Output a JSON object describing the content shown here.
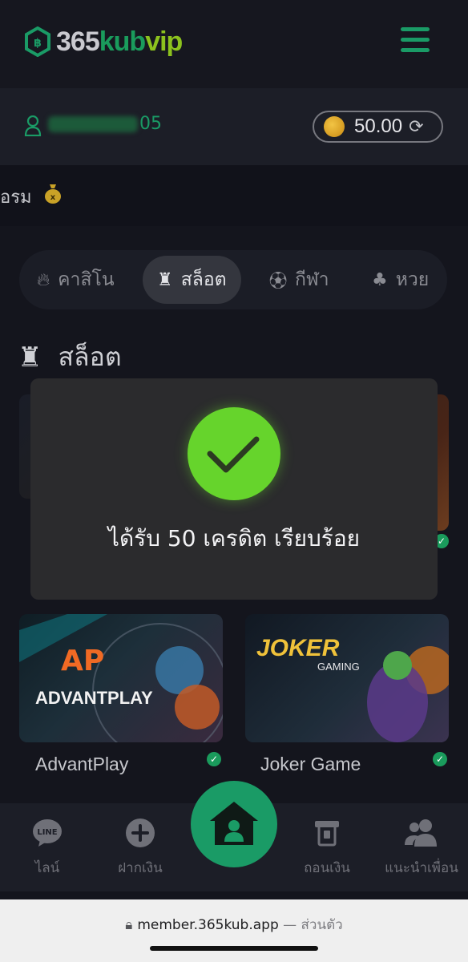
{
  "header": {
    "logo": {
      "part1": "365",
      "part2": "kub",
      "part3": "vip"
    },
    "menu_icon": "hamburger-icon"
  },
  "user": {
    "id_suffix": "05",
    "balance": "50.00",
    "icon": "user-icon"
  },
  "marquee": {
    "text": "อรม"
  },
  "category_tabs": [
    {
      "label": "คาสิโน",
      "icon": "fire-icon",
      "active": false
    },
    {
      "label": "สล็อต",
      "icon": "slot-icon",
      "active": true
    },
    {
      "label": "กีฬา",
      "icon": "soccer-ball-icon",
      "active": false
    },
    {
      "label": "หวย",
      "icon": "clover-icon",
      "active": false
    }
  ],
  "section": {
    "title": "สล็อต"
  },
  "games": [
    {
      "name": "AdvantPlay",
      "logo_main": "AP",
      "logo_sub": "ADVANTPLAY"
    },
    {
      "name": "Joker Game",
      "logo_main": "JOKER",
      "logo_sub": "GAMING"
    }
  ],
  "modal": {
    "message": "ได้รับ 50 เครดิต เรียบร้อย",
    "accent": "#66d42c"
  },
  "bottom_nav": [
    {
      "label": "ไลน์",
      "icon": "line-icon"
    },
    {
      "label": "ฝากเงิน",
      "icon": "plus-circle-icon"
    },
    {
      "label": "",
      "icon": "home-icon"
    },
    {
      "label": "ถอนเงิน",
      "icon": "withdraw-icon"
    },
    {
      "label": "แนะนำเพื่อน",
      "icon": "friends-icon"
    }
  ],
  "browser": {
    "url": "member.365kub.app",
    "suffix": "— ส่วนตัว"
  },
  "colors": {
    "brand_green": "#1a9b66",
    "lime": "#8cc21e",
    "background": "#14151d"
  }
}
